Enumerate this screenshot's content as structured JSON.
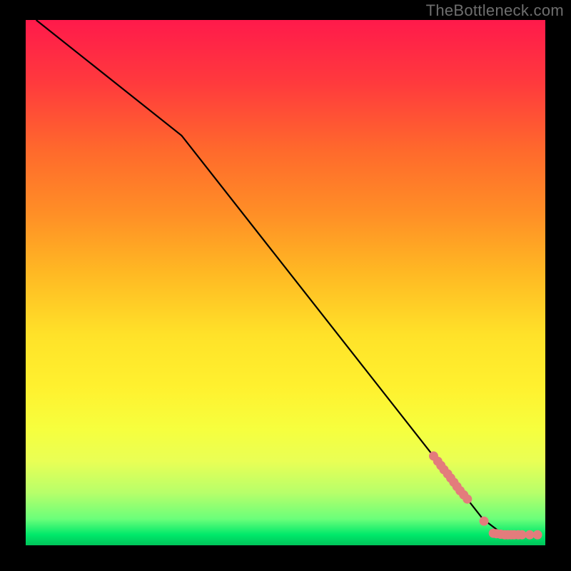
{
  "watermark": "TheBottleneck.com",
  "chart_data": {
    "type": "line",
    "title": "",
    "xlabel": "",
    "ylabel": "",
    "xlim": [
      0,
      100
    ],
    "ylim": [
      0,
      100
    ],
    "series": [
      {
        "name": "curve",
        "style": "line",
        "color": "#000000",
        "x": [
          2,
          30,
          88,
          92,
          97
        ],
        "y": [
          100,
          78,
          5,
          2,
          2
        ]
      },
      {
        "name": "markers",
        "style": "scatter",
        "color": "#e37c7c",
        "x": [
          78.5,
          79.3,
          79.9,
          80.5,
          81.2,
          81.8,
          82.4,
          83.0,
          83.6,
          84.3,
          85.0,
          88.2,
          90.0,
          90.6,
          91.4,
          92.2,
          92.8,
          93.4,
          94.0,
          94.8,
          95.5,
          97.0,
          98.5
        ],
        "y": [
          17.0,
          16.0,
          15.2,
          14.4,
          13.6,
          12.8,
          12.0,
          11.2,
          10.4,
          9.6,
          8.8,
          4.6,
          2.3,
          2.2,
          2.1,
          2.0,
          2.0,
          2.0,
          2.0,
          2.0,
          2.0,
          2.0,
          2.0
        ]
      }
    ]
  }
}
